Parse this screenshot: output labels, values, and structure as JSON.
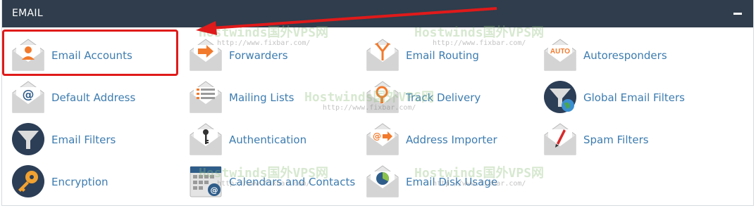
{
  "panel": {
    "title": "EMAIL"
  },
  "items": [
    {
      "label": "Email Accounts",
      "icon": "email-accounts-icon"
    },
    {
      "label": "Forwarders",
      "icon": "forwarders-icon"
    },
    {
      "label": "Email Routing",
      "icon": "email-routing-icon"
    },
    {
      "label": "Autoresponders",
      "icon": "autoresponders-icon",
      "badge": "AUTO"
    },
    {
      "label": "Default Address",
      "icon": "default-address-icon",
      "badge": "@"
    },
    {
      "label": "Mailing Lists",
      "icon": "mailing-lists-icon"
    },
    {
      "label": "Track Delivery",
      "icon": "track-delivery-icon"
    },
    {
      "label": "Global Email Filters",
      "icon": "global-email-filters-icon"
    },
    {
      "label": "Email Filters",
      "icon": "email-filters-icon"
    },
    {
      "label": "Authentication",
      "icon": "authentication-icon"
    },
    {
      "label": "Address Importer",
      "icon": "address-importer-icon",
      "badge": "@"
    },
    {
      "label": "Spam Filters",
      "icon": "spam-filters-icon"
    },
    {
      "label": "Encryption",
      "icon": "encryption-icon"
    },
    {
      "label": "Calendars and Contacts",
      "icon": "calendars-contacts-icon",
      "badge": "@"
    },
    {
      "label": "Email Disk Usage",
      "icon": "email-disk-usage-icon"
    }
  ],
  "watermark": {
    "brand": "Hostwinds国外VPS网",
    "url": "http://www.fixbar.com/"
  },
  "colors": {
    "header": "#2f3d4c",
    "link": "#3d7cb0",
    "accent": "#f27a2c",
    "highlight": "#e01a1a"
  }
}
